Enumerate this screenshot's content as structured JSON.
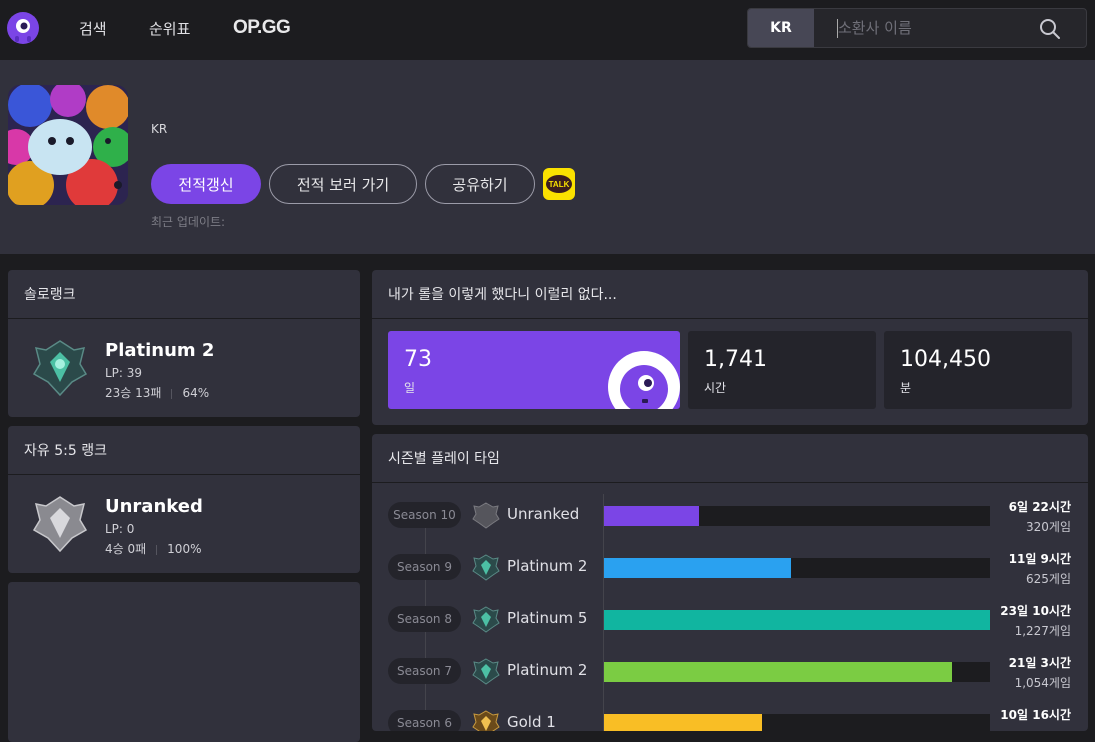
{
  "nav": {
    "items": [
      "검색",
      "순위표"
    ],
    "brand": "OP.GG"
  },
  "search": {
    "region": "KR",
    "placeholder": "소환사 이름"
  },
  "profile": {
    "region": "KR",
    "buttons": {
      "refresh": "전적갱신",
      "view_history": "전적 보러 가기",
      "share": "공유하기"
    },
    "kakao_label": "TALK",
    "last_updated_label": "최근 업데이트:"
  },
  "solo_rank": {
    "title": "솔로랭크",
    "tier": "Platinum 2",
    "lp": "LP: 39",
    "record": "23승 13패",
    "winrate": "64%"
  },
  "flex_rank": {
    "title": "자유 5:5 랭크",
    "tier": "Unranked",
    "lp": "LP: 0",
    "record": "4승 0패",
    "winrate": "100%"
  },
  "playtime": {
    "title": "내가 롤을 이렇게 했다니 이럴리 없다...",
    "stats": [
      {
        "value": "73",
        "unit": "일"
      },
      {
        "value": "1,741",
        "unit": "시간"
      },
      {
        "value": "104,450",
        "unit": "분"
      }
    ]
  },
  "season_playtime": {
    "title": "시즌별 플레이 타임",
    "rows": [
      {
        "season": "Season 10",
        "tier": "Unranked",
        "time": "6일 22시간",
        "games": "320게임",
        "fraction": 0.247,
        "color": "#7b45e6",
        "emblem": "unranked-emblem"
      },
      {
        "season": "Season 9",
        "tier": "Platinum 2",
        "time": "11일 9시간",
        "games": "625게임",
        "fraction": 0.484,
        "color": "#2aa1f0",
        "emblem": "platinum-emblem"
      },
      {
        "season": "Season 8",
        "tier": "Platinum 5",
        "time": "23일 10시간",
        "games": "1,227게임",
        "fraction": 1.0,
        "color": "#11b5a0",
        "emblem": "platinum-emblem"
      },
      {
        "season": "Season 7",
        "tier": "Platinum 2",
        "time": "21일 3시간",
        "games": "1,054게임",
        "fraction": 0.901,
        "color": "#7bcc43",
        "emblem": "platinum-emblem"
      },
      {
        "season": "Season 6",
        "tier": "Gold 1",
        "time": "10일 16시간",
        "games": "",
        "fraction": 0.409,
        "color": "#f9be25",
        "emblem": "gold-emblem"
      }
    ]
  }
}
